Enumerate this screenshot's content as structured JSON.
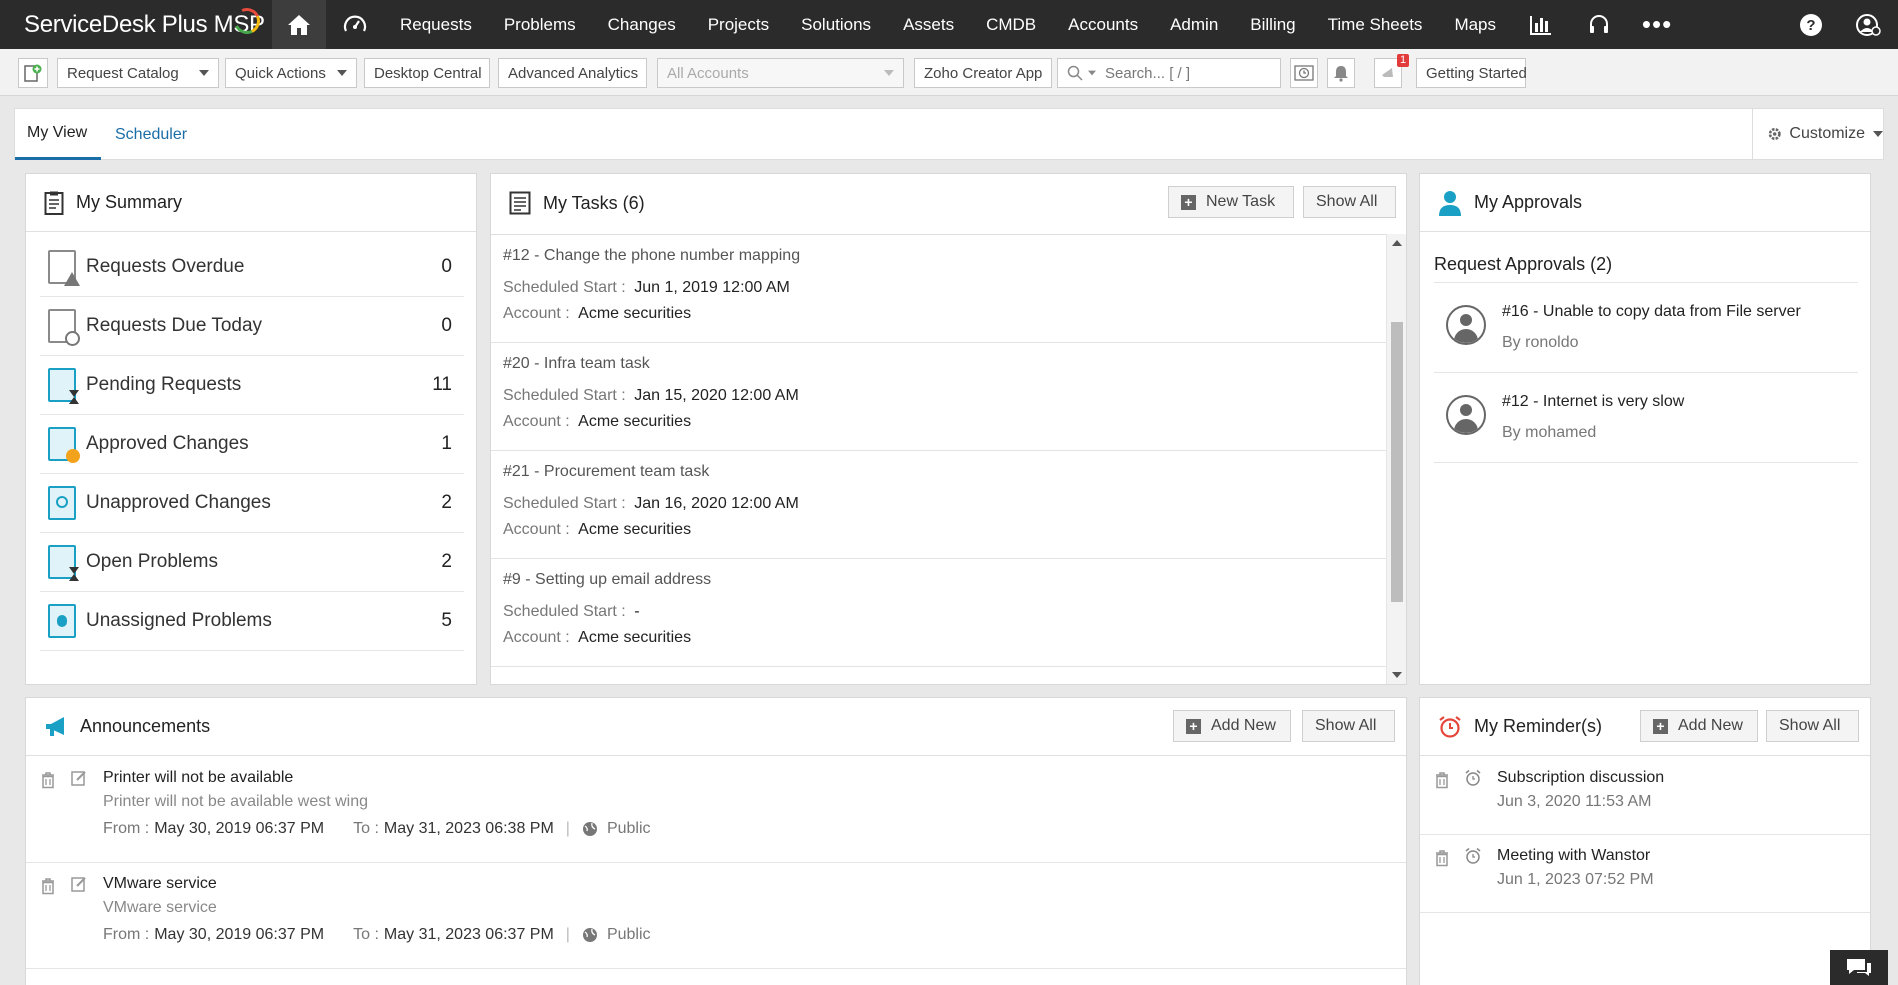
{
  "app": {
    "name": "ServiceDesk Plus MSP"
  },
  "nav": {
    "items": [
      "Requests",
      "Problems",
      "Changes",
      "Projects",
      "Solutions",
      "Assets",
      "CMDB",
      "Accounts",
      "Admin",
      "Billing",
      "Time Sheets",
      "Maps"
    ]
  },
  "toolbar": {
    "request_catalog": "Request Catalog",
    "quick_actions": "Quick Actions",
    "desktop_central": "Desktop Central",
    "advanced_analytics": "Advanced Analytics",
    "accounts_select": "All Accounts",
    "zoho_creator": "Zoho Creator App",
    "search_placeholder": "Search... [ / ]",
    "notification_count": "1",
    "getting_started": "Getting Started"
  },
  "tabs": {
    "my_view": "My View",
    "scheduler": "Scheduler",
    "customize": "Customize"
  },
  "summary": {
    "title": "My Summary",
    "rows": [
      {
        "label": "Requests Overdue",
        "value": "0"
      },
      {
        "label": "Requests Due Today",
        "value": "0"
      },
      {
        "label": "Pending Requests",
        "value": "11"
      },
      {
        "label": "Approved Changes",
        "value": "1"
      },
      {
        "label": "Unapproved Changes",
        "value": "2"
      },
      {
        "label": "Open Problems",
        "value": "2"
      },
      {
        "label": "Unassigned Problems",
        "value": "5"
      }
    ]
  },
  "tasks": {
    "title": "My Tasks (6)",
    "new_task": "New Task",
    "show_all": "Show All",
    "start_label": "Scheduled Start :",
    "account_label": "Account :",
    "items": [
      {
        "title": "#12 - Change the phone number mapping",
        "start": "Jun 1, 2019 12:00 AM",
        "account": "Acme securities"
      },
      {
        "title": "#20 - Infra team task",
        "start": "Jan 15, 2020 12:00 AM",
        "account": "Acme securities"
      },
      {
        "title": "#21 - Procurement team task",
        "start": "Jan 16, 2020 12:00 AM",
        "account": "Acme securities"
      },
      {
        "title": "#9 - Setting up email address",
        "start": "-",
        "account": "Acme securities"
      }
    ]
  },
  "approvals": {
    "title": "My Approvals",
    "subtitle": "Request Approvals (2)",
    "items": [
      {
        "title": "#16 - Unable to copy data from File server",
        "by": "By ronoldo"
      },
      {
        "title": "#12 - Internet is very slow",
        "by": "By mohamed"
      }
    ]
  },
  "announcements": {
    "title": "Announcements",
    "add_new": "Add New",
    "show_all": "Show All",
    "from_label": "From :",
    "to_label": "To :",
    "items": [
      {
        "title": "Printer will not be available",
        "desc": "Printer will not be available west wing",
        "from": "May 30, 2019 06:37 PM",
        "to": "May 31, 2023 06:38 PM",
        "visibility": "Public"
      },
      {
        "title": "VMware service",
        "desc": "VMware service",
        "from": "May 30, 2019 06:37 PM",
        "to": "May 31, 2023 06:37 PM",
        "visibility": "Public"
      }
    ]
  },
  "reminders": {
    "title": "My Reminder(s)",
    "add_new": "Add New",
    "show_all": "Show All",
    "items": [
      {
        "title": "Subscription discussion",
        "time": "Jun 3, 2020 11:53 AM"
      },
      {
        "title": "Meeting with Wanstor",
        "time": "Jun 1, 2023 07:52 PM"
      }
    ]
  },
  "colors": {
    "nav_bg": "#2b2b2b",
    "accent_blue": "#1a6ea8",
    "teal": "#1aa0c4",
    "reminder_red": "#e5463b"
  }
}
